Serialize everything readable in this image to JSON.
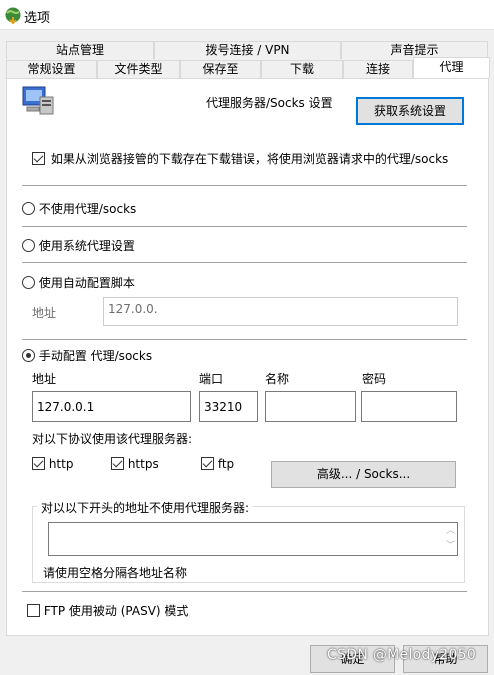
{
  "window": {
    "title": "选项"
  },
  "tabs_row1": [
    {
      "label": "站点管理"
    },
    {
      "label": "拨号连接 / VPN"
    },
    {
      "label": "声音提示"
    }
  ],
  "tabs_row2": [
    {
      "label": "常规设置"
    },
    {
      "label": "文件类型"
    },
    {
      "label": "保存至"
    },
    {
      "label": "下载"
    },
    {
      "label": "连接"
    },
    {
      "label": "代理",
      "active": true
    }
  ],
  "proxy": {
    "heading": "代理服务器/Socks 设置",
    "get_system_settings": "获取系统设置",
    "browser_proxy_checkbox": {
      "label": "如果从浏览器接管的下载存在下载错误，将使用浏览器请求中的代理/socks",
      "checked": true
    },
    "options": {
      "no_proxy": "不使用代理/socks",
      "system_proxy": "使用系统代理设置",
      "auto_script": "使用自动配置脚本",
      "manual": "手动配置 代理/socks"
    },
    "selected_option": "manual",
    "auto_script_address_label": "地址",
    "auto_script_address_value": "127.0.0.",
    "manual_fields": {
      "address_label": "地址",
      "address_value": "127.0.0.1",
      "port_label": "端口",
      "port_value": "33210",
      "name_label": "名称",
      "name_value": "",
      "password_label": "密码",
      "password_value": ""
    },
    "protocols_label": "对以下协议使用该代理服务器:",
    "protocols": [
      {
        "label": "http",
        "checked": true
      },
      {
        "label": "https",
        "checked": true
      },
      {
        "label": "ftp",
        "checked": true
      }
    ],
    "advanced_button": "高级... / Socks...",
    "bypass_group_label": "对以以下开头的地址不使用代理服务器:",
    "bypass_value": "",
    "bypass_hint": "请使用空格分隔各地址名称",
    "ftp_passive": {
      "label": "FTP 使用被动 (PASV) 模式",
      "checked": false
    }
  },
  "footer": {
    "ok": "确定",
    "help": "帮助"
  },
  "watermark": "CSDN @Melody2050"
}
